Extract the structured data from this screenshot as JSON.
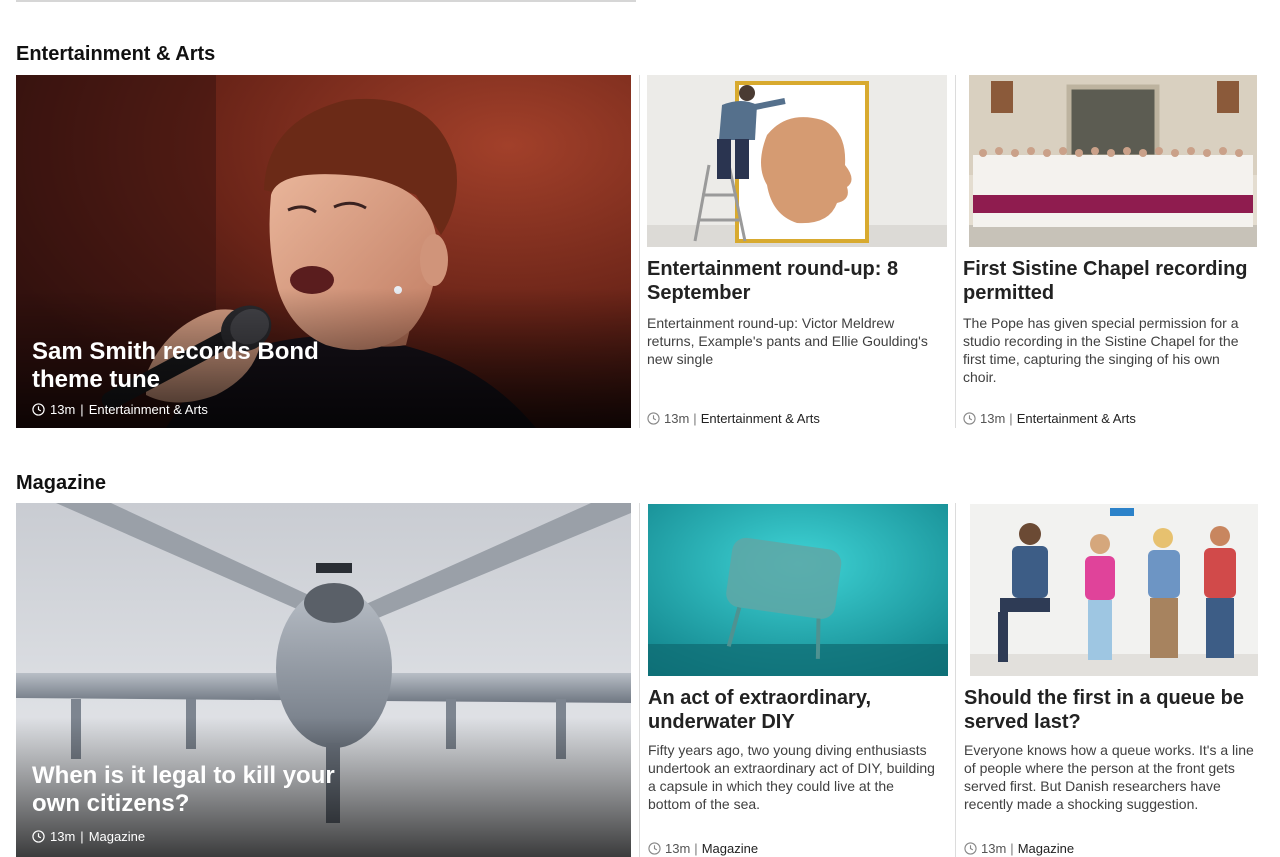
{
  "sections": [
    {
      "title": "Entertainment & Arts",
      "lead": {
        "headline": "Sam Smith records Bond theme tune",
        "time": "13m",
        "section": "Entertainment & Arts"
      },
      "cards": [
        {
          "headline": "Entertainment round-up: 8 September",
          "summary": "Entertainment round-up: Victor Meldrew returns, Example's pants and Ellie Goulding's new single",
          "time": "13m",
          "section": "Entertainment & Arts"
        },
        {
          "headline": "First Sistine Chapel recording permitted",
          "summary": "The Pope has given special permission for a studio recording in the Sistine Chapel for the first time, capturing the singing of his own choir.",
          "time": "13m",
          "section": "Entertainment & Arts"
        }
      ]
    },
    {
      "title": "Magazine",
      "lead": {
        "headline": "When is it legal to kill your own citizens?",
        "time": "13m",
        "section": "Magazine"
      },
      "cards": [
        {
          "headline": "An act of extraordinary, underwater DIY",
          "summary": "Fifty years ago, two young diving enthusiasts undertook an extraordinary act of DIY, building a capsule in which they could live at the bottom of the sea.",
          "time": "13m",
          "section": "Magazine"
        },
        {
          "headline": "Should the first in a queue be served last?",
          "summary": "Everyone knows how a queue works. It's a line of people where the person at the front gets served first. But Danish researchers have recently made a shocking suggestion.",
          "time": "13m",
          "section": "Magazine"
        }
      ]
    }
  ],
  "meta_separator": "|",
  "icons": {
    "timestamp": "clock-icon"
  },
  "colors": {
    "text": "#222222",
    "summary": "#404040",
    "divider": "#dcdcdc"
  }
}
